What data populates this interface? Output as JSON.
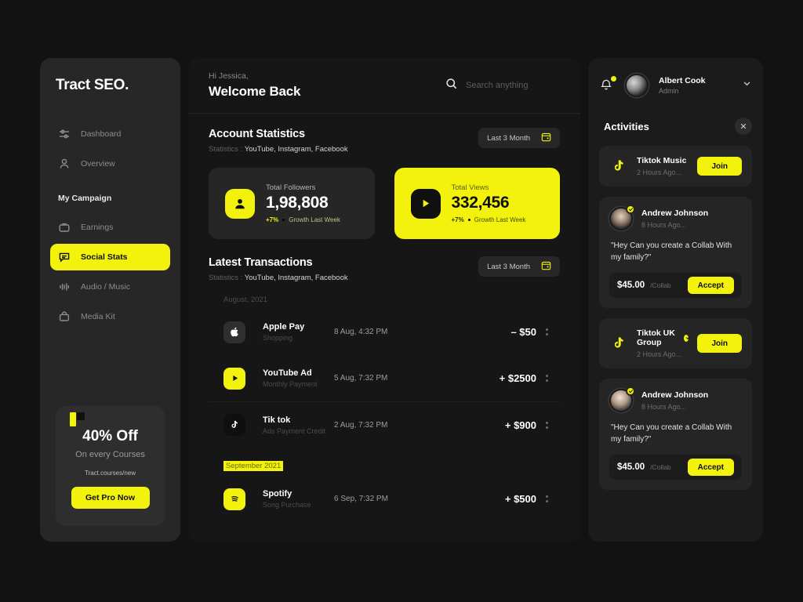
{
  "brand": {
    "name": "Tract SEO."
  },
  "sidebar": {
    "items": [
      {
        "label": "Dashboard",
        "icon": "sliders-icon",
        "active": false
      },
      {
        "label": "Overview",
        "icon": "user-icon",
        "active": false
      }
    ],
    "section_label": "My Campaign",
    "campaign_items": [
      {
        "label": "Earnings",
        "icon": "briefcase-icon",
        "active": false
      },
      {
        "label": "Social Stats",
        "icon": "chat-bubble-icon",
        "active": true
      },
      {
        "label": "Audio / Music",
        "icon": "audio-wave-icon",
        "active": false
      },
      {
        "label": "Media Kit",
        "icon": "bag-icon",
        "active": false
      }
    ],
    "promo": {
      "title": "40% Off",
      "subtitle": "On every Courses",
      "url": "Tract.courses/new",
      "button": "Get Pro Now"
    }
  },
  "header": {
    "greeting_small": "Hi Jessica,",
    "greeting_large": "Welcome Back",
    "search_placeholder": "Search anything",
    "search_value": ""
  },
  "account_statistics": {
    "title": "Account Statistics",
    "subtitle_prefix": "Statistics : ",
    "subtitle_value": "YouTube, Instagram, Facebook",
    "period": "Last 3 Month",
    "cards": [
      {
        "label": "Total Followers",
        "value": "1,98,808",
        "growth_pct": "+7%",
        "growth_text": "Growth Last Week",
        "icon": "user-icon",
        "style": "dark"
      },
      {
        "label": "Total Views",
        "value": "332,456",
        "growth_pct": "+7%",
        "growth_text": "Growth Last Week",
        "icon": "play-icon",
        "style": "bright"
      }
    ]
  },
  "latest_transactions": {
    "title": "Latest Transactions",
    "subtitle_prefix": "Statistics : ",
    "subtitle_value": "YouTube, Instagram, Facebook",
    "period": "Last 3 Month",
    "groups": [
      {
        "month": "August, 2021",
        "selected": false,
        "rows": [
          {
            "name": "Apple Pay",
            "sub": "Shopping",
            "date": "8 Aug, 4:32 PM",
            "amount": "–  $50",
            "icon": "apple-icon"
          },
          {
            "name": "YouTube Ad",
            "sub": "Monthly Payment",
            "date": "5 Aug, 7:32 PM",
            "amount": "+ $2500",
            "icon": "youtube-icon"
          },
          {
            "name": "Tik tok",
            "sub": "Ads Payment Credit",
            "date": "2 Aug, 7:32 PM",
            "amount": "+ $900",
            "icon": "tiktok-icon"
          }
        ]
      },
      {
        "month": "September 2021",
        "selected": true,
        "rows": [
          {
            "name": "Spotify",
            "sub": "Song Purchase",
            "date": "6 Sep, 7:32 PM",
            "amount": "+ $500",
            "icon": "spotify-icon"
          }
        ]
      }
    ]
  },
  "right_panel": {
    "user": {
      "name": "Albert Cook",
      "role": "Admin"
    },
    "activities_title": "Activities",
    "close_label": "✕",
    "cards": [
      {
        "type": "join",
        "name": "Tiktok Music",
        "verified": false,
        "time": "2 Hours Ago...",
        "button": "Join",
        "icon": "tiktok-icon"
      },
      {
        "type": "message",
        "name": "Andrew Johnson",
        "verified": true,
        "time": "8 Hours Ago...",
        "message": "\"Hey Can you create a Collab With my family?\"",
        "amount": "$45.00",
        "unit": "/Collab",
        "button": "Accept",
        "avatar": "p2"
      },
      {
        "type": "join",
        "name": "Tiktok UK Group",
        "verified": true,
        "time": "2 Hours Ago...",
        "button": "Join",
        "icon": "tiktok-icon"
      },
      {
        "type": "message",
        "name": "Andrew Johnson",
        "verified": true,
        "time": "8 Hours Ago...",
        "message": "\"Hey Can you create a Collab With my family?\"",
        "amount": "$45.00",
        "unit": "/Collab",
        "button": "Accept",
        "avatar": "p3"
      }
    ]
  },
  "colors": {
    "accent": "#F2F20D",
    "bg": "#121212",
    "panel": "#1b1b1b",
    "sidebar": "#272727",
    "main": "#161616"
  }
}
